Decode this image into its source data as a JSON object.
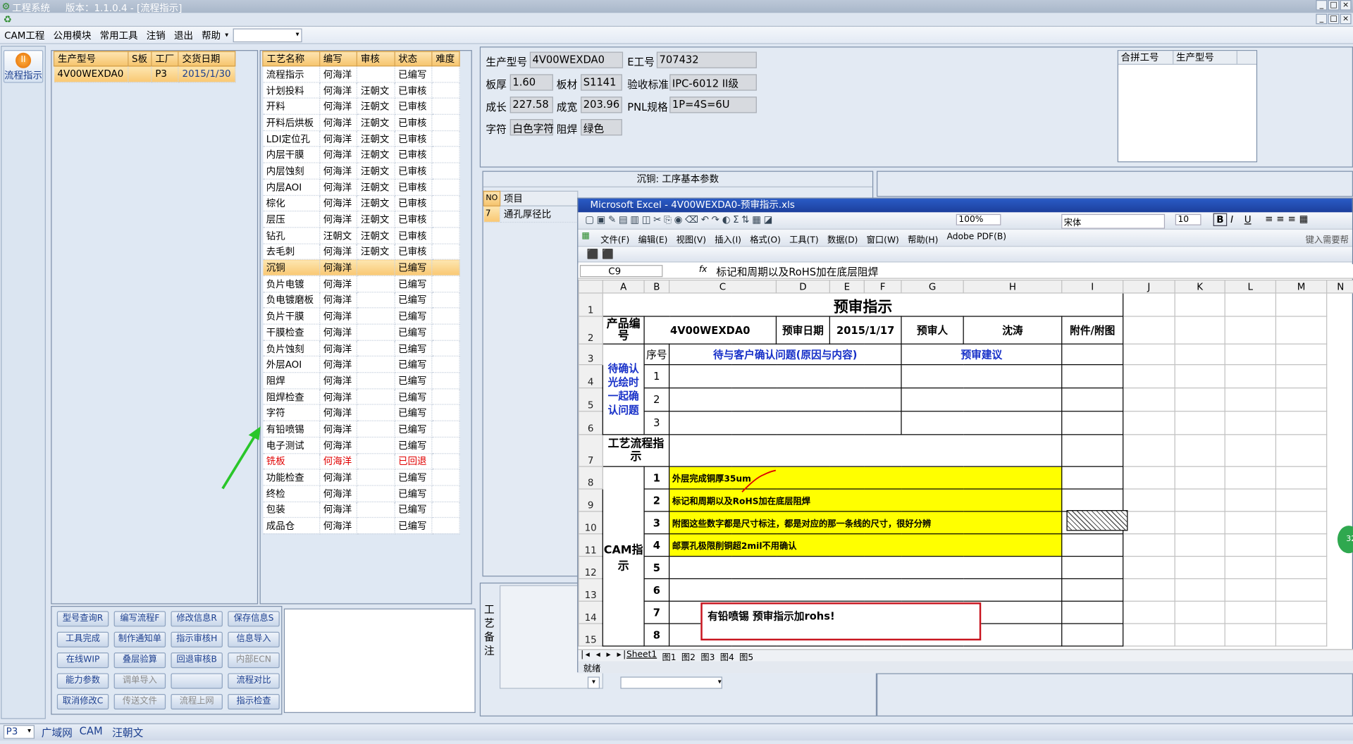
{
  "app": {
    "title": "工程系统",
    "version": "版本：1.1.0.4 - [流程指示]",
    "win_min": "_",
    "win_max": "□",
    "win_close": "×"
  },
  "menu": [
    "CAM工程",
    "公用模块",
    "常用工具",
    "注销",
    "退出",
    "帮助"
  ],
  "side": {
    "button": "流程指示"
  },
  "orders": {
    "headers": [
      "生产型号",
      "S板",
      "工厂",
      "交货日期"
    ],
    "rows": [
      [
        "4V00WEXDA0",
        "",
        "P3",
        "2015/1/30"
      ]
    ]
  },
  "process": {
    "headers": [
      "工艺名称",
      "编写",
      "审核",
      "状态",
      "难度"
    ],
    "rows": [
      [
        "流程指示",
        "何海洋",
        "",
        "已编写",
        ""
      ],
      [
        "计划投料",
        "何海洋",
        "汪朝文",
        "已审核",
        ""
      ],
      [
        "开料",
        "何海洋",
        "汪朝文",
        "已审核",
        ""
      ],
      [
        "开料后烘板",
        "何海洋",
        "汪朝文",
        "已审核",
        ""
      ],
      [
        "LDI定位孔",
        "何海洋",
        "汪朝文",
        "已审核",
        ""
      ],
      [
        "内层干膜",
        "何海洋",
        "汪朝文",
        "已审核",
        ""
      ],
      [
        "内层蚀刻",
        "何海洋",
        "汪朝文",
        "已审核",
        ""
      ],
      [
        "内层AOI",
        "何海洋",
        "汪朝文",
        "已审核",
        ""
      ],
      [
        "棕化",
        "何海洋",
        "汪朝文",
        "已审核",
        ""
      ],
      [
        "层压",
        "何海洋",
        "汪朝文",
        "已审核",
        ""
      ],
      [
        "钻孔",
        "汪朝文",
        "汪朝文",
        "已审核",
        ""
      ],
      [
        "去毛刺",
        "何海洋",
        "汪朝文",
        "已审核",
        ""
      ],
      [
        "沉铜",
        "何海洋",
        "",
        "已编写",
        ""
      ],
      [
        "负片电镀",
        "何海洋",
        "",
        "已编写",
        ""
      ],
      [
        "负电镀磨板",
        "何海洋",
        "",
        "已编写",
        ""
      ],
      [
        "负片干膜",
        "何海洋",
        "",
        "已编写",
        ""
      ],
      [
        "干膜检查",
        "何海洋",
        "",
        "已编写",
        ""
      ],
      [
        "负片蚀刻",
        "何海洋",
        "",
        "已编写",
        ""
      ],
      [
        "外层AOI",
        "何海洋",
        "",
        "已编写",
        ""
      ],
      [
        "阻焊",
        "何海洋",
        "",
        "已编写",
        ""
      ],
      [
        "阻焊检查",
        "何海洋",
        "",
        "已编写",
        ""
      ],
      [
        "字符",
        "何海洋",
        "",
        "已编写",
        ""
      ],
      [
        "有铅喷锡",
        "何海洋",
        "",
        "已编写",
        ""
      ],
      [
        "电子测试",
        "何海洋",
        "",
        "已编写",
        ""
      ],
      [
        "铣板",
        "何海洋",
        "",
        "已回退",
        ""
      ],
      [
        "功能检查",
        "何海洋",
        "",
        "已编写",
        ""
      ],
      [
        "终检",
        "何海洋",
        "",
        "已编写",
        ""
      ],
      [
        "包装",
        "何海洋",
        "",
        "已编写",
        ""
      ],
      [
        "成品仓",
        "何海洋",
        "",
        "已编写",
        ""
      ]
    ],
    "selected_index": 12,
    "red_index": 24
  },
  "buttons": [
    [
      "型号查询R",
      "编写流程F",
      "修改信息R",
      "保存信息S"
    ],
    [
      "工具完成",
      "制作通知单",
      "指示审核H",
      "信息导入"
    ],
    [
      "在线WIP",
      "叠层验算",
      "回退审核B",
      "内部ECN"
    ],
    [
      "能力参数",
      "调单导入",
      "",
      "流程对比"
    ],
    [
      "取消修改C",
      "传送文件",
      "流程上网",
      "指示检查"
    ]
  ],
  "info": {
    "l_model": "生产型号",
    "model": "4V00WEXDA0",
    "l_e": "E工号",
    "e": "707432",
    "l_thick": "板厚",
    "thick": "1.60",
    "l_mat": "板材",
    "mat": "S1141",
    "l_std": "验收标准",
    "std": "IPC-6012 II级",
    "l_len": "成长",
    "len": "227.58",
    "l_wid": "成宽",
    "wid": "203.96",
    "l_pnl": "PNL规格",
    "pnl": "1P=4S=6U",
    "l_char": "字符",
    "char": "白色字符",
    "l_mask": "阻焊",
    "mask": "绿色"
  },
  "merge": {
    "headers": [
      "合拼工号",
      "生产型号"
    ]
  },
  "param": {
    "title": "沉铜: 工序基本参数",
    "headers": [
      "NO",
      "项目"
    ],
    "rows": [
      [
        "7",
        "通孔厚径比"
      ]
    ]
  },
  "remark": {
    "label": "工艺备注"
  },
  "excel": {
    "title": "Microsoft Excel - 4V00WEXDA0-预审指示.xls",
    "menu": [
      "文件(F)",
      "编辑(E)",
      "视图(V)",
      "插入(I)",
      "格式(O)",
      "工具(T)",
      "数据(D)",
      "窗口(W)",
      "帮助(H)",
      "Adobe PDF(B)"
    ],
    "zoom": "100%",
    "font": "宋体",
    "size": "10",
    "help_hint": "键入需要帮",
    "cellref": "C9",
    "fx": "fx",
    "formula": "标记和周期以及RoHS加在底层阻焊",
    "cols": [
      "A",
      "B",
      "C",
      "D",
      "E",
      "F",
      "G",
      "H",
      "I",
      "J",
      "K",
      "L",
      "M",
      "N"
    ],
    "title_cell": "预审指示",
    "l_prod": "产品编号",
    "prod": "4V00WEXDA0",
    "l_date": "预审日期",
    "date": "2015/1/17",
    "l_reviewer": "预审人",
    "reviewer": "沈涛",
    "l_att": "附件/附图",
    "l_seq": "序号",
    "l_issue": "待与客户确认问题(原因与内容)",
    "l_sugg": "预审建议",
    "l_pending": "待确认光绘时一起确认问题",
    "l_flow": "工艺流程指示",
    "l_cam": "CAM指示",
    "items": [
      "外层完成铜厚35um",
      "标记和周期以及RoHS加在底层阻焊",
      "附图这些数字都是尺寸标注，都是对应的那一条线的尺寸，很好分辨",
      "邮票孔极限削铜超2mil不用确认"
    ],
    "note": "有铅喷锡 预审指示加rohs!",
    "tabs": [
      "Sheet1",
      "图1",
      "图2",
      "图3",
      "图4",
      "图5"
    ],
    "status": "就绪"
  },
  "statusbar": {
    "factory": "P3",
    "net": "广域网",
    "dept": "CAM",
    "user": "汪朝文"
  },
  "badge": "32"
}
